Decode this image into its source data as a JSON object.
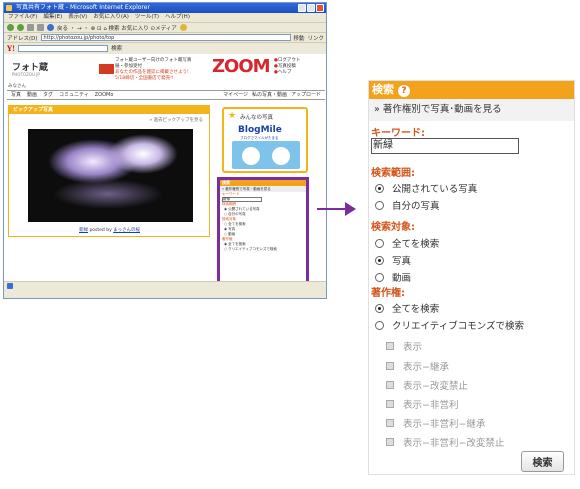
{
  "browser": {
    "title": "写真共有フォト蔵 - Microsoft Internet Explorer",
    "menu": [
      "ファイル(F)",
      "編集(E)",
      "表示(V)",
      "お気に入り(A)",
      "ツール(T)",
      "ヘルプ(H)"
    ],
    "toolbar_text": "戻る ・ → ・ ⊗ ⊡ ⌂  検索  お気に入り  ⊙メディア",
    "address_label": "アドレス(D)",
    "address_value": "http://photozou.jp/photo/top",
    "go_label": "移動",
    "links_label": "リンク",
    "search_label": "検索",
    "site": {
      "logo": "フォト蔵",
      "logo_sub": "PHOTOZOU.JP",
      "promo_line1": "フォト蔵ユーザー向けのフォト蔵写真展・参加受付",
      "promo_line2": "あなたの作品を雑誌に掲載させよう!",
      "promo_line3": "5/18締切・全国書店で発売!!",
      "zoom_logo": "ZOOM",
      "header_links": [
        "ログアウト",
        "写真投稿",
        "ヘルプ"
      ],
      "user_line": "みなさん",
      "nav": [
        "写真",
        "動画",
        "タグ",
        "コミュニティ",
        "ZOOMo"
      ],
      "nav_right": [
        "マイページ",
        "私の写真・動画",
        "アップロード"
      ],
      "pickup_title": "ピックアップ写真",
      "pickup_link": "» 過去ピックアップを見る",
      "photo_caption_title": "新緑",
      "photo_caption_by": "posted by",
      "photo_caption_user": "まっさんの桜",
      "minna_title": "みんなの写真",
      "blogmile": "BlogMile",
      "blogmile_sub": "ブログでマイルがたまる"
    }
  },
  "mini_panel": {
    "title": "検索",
    "rights": "» 著作権別で写真・動画を見る",
    "keyword_label": "キーワード",
    "keyword": "新緑",
    "scope_label": "検索範囲",
    "scope_options": [
      "公開されている写真",
      "自分の写真"
    ],
    "target_label": "検索対象",
    "target_options": [
      "全てを検索",
      "写真",
      "動画"
    ],
    "rights_label": "著作権",
    "rights_options": [
      "全てを検索",
      "クリエイティブコモンズで検索"
    ]
  },
  "panel": {
    "title": "検索",
    "rights_link": "» 著作権別で写真･動画を見る",
    "keyword_label": "キーワード:",
    "keyword_value": "新緑",
    "scope_label": "検索範囲:",
    "scope_options": [
      "公開されている写真",
      "自分の写真"
    ],
    "target_label": "検索対象:",
    "target_options": [
      "全てを検索",
      "写真",
      "動画"
    ],
    "rights_label": "著作権:",
    "rights_options": [
      "全てを検索",
      "クリエイティブコモンズで検索"
    ],
    "cc_options": [
      "表示",
      "表示−継承",
      "表示−改変禁止",
      "表示−非営利",
      "表示−非営利−継承",
      "表示−非営利−改変禁止"
    ],
    "search_button": "検索"
  },
  "colors": {
    "accent_orange": "#f2a31b",
    "label_orange": "#d2561b",
    "highlight_purple": "#7b2d9e",
    "zoom_red": "#d8262e"
  },
  "icons": {
    "help": "question-circle-icon",
    "arrow": "right-arrow-icon"
  }
}
